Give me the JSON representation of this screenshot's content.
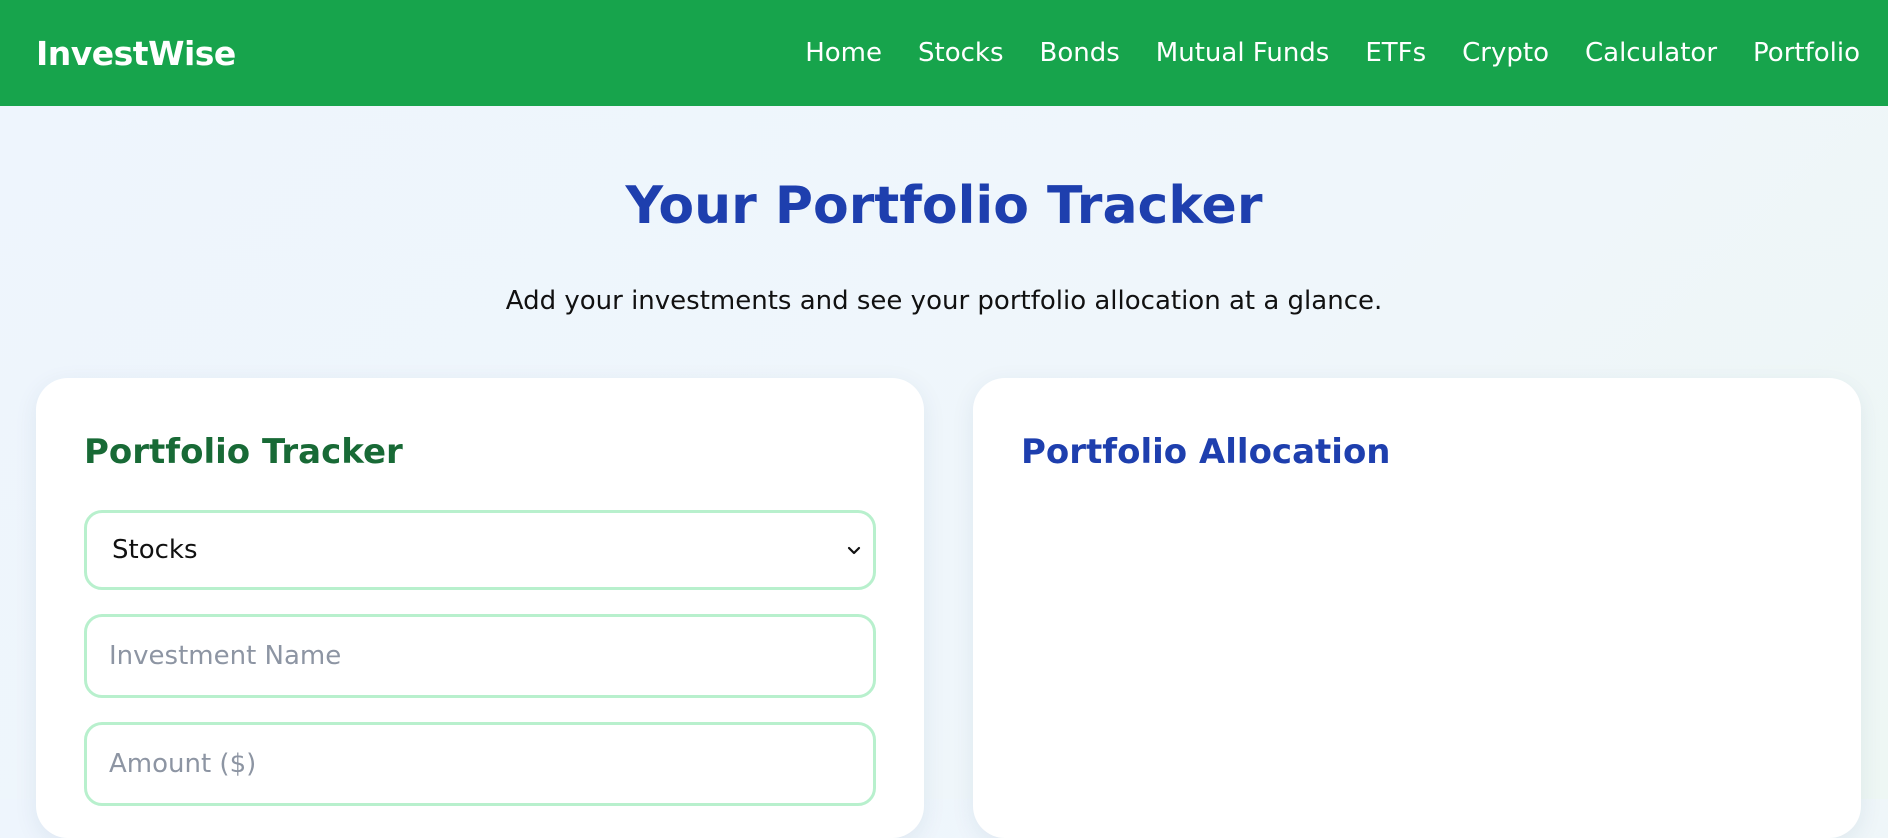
{
  "header": {
    "brand": "InvestWise",
    "nav": [
      "Home",
      "Stocks",
      "Bonds",
      "Mutual Funds",
      "ETFs",
      "Crypto",
      "Calculator",
      "Portfolio"
    ]
  },
  "hero": {
    "title": "Your Portfolio Tracker",
    "subtitle": "Add your investments and see your portfolio allocation at a glance."
  },
  "tracker": {
    "title": "Portfolio Tracker",
    "type_select": {
      "value": "Stocks"
    },
    "name_input": {
      "placeholder": "Investment Name"
    },
    "amount_input": {
      "placeholder": "Amount ($)"
    }
  },
  "allocation": {
    "title": "Portfolio Allocation"
  },
  "colors": {
    "navbar": "#17a44c",
    "primary_blue": "#1e3fae",
    "tracker_green": "#186a36",
    "input_border": "#b8f0cd"
  }
}
